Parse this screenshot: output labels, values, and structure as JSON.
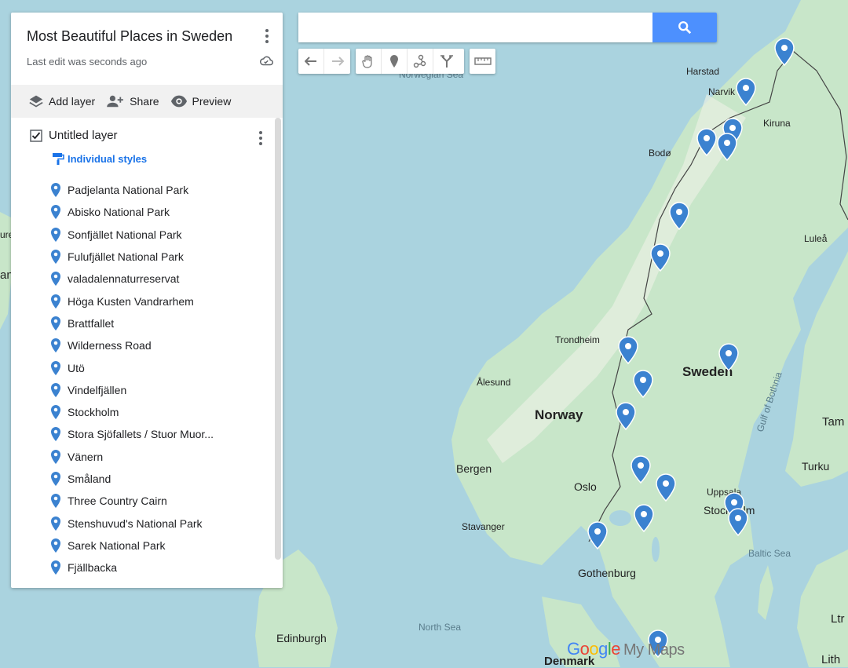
{
  "map_title": "Most Beautiful Places in Sweden",
  "map_subtitle": "Last edit was seconds ago",
  "toolbar": {
    "add_layer": "Add layer",
    "share": "Share",
    "preview": "Preview"
  },
  "layer": {
    "name": "Untitled layer",
    "checked": true,
    "styles_label": "Individual styles",
    "places": [
      "Padjelanta National Park",
      "Abisko National Park",
      "Sonfjället National Park",
      "Fulufjället National Park",
      "valadalennaturreservat",
      "Höga Kusten Vandrarhem",
      "Brattfallet",
      "Wilderness Road",
      "Utö",
      "Vindelfjällen",
      "Stockholm",
      "Stora Sjöfallets / Stuor Muor...",
      "Vänern",
      "Småland",
      "Three Country Cairn",
      "Stenshuvud's National Park",
      "Sarek National Park",
      "Fjällbacka"
    ]
  },
  "search": {
    "value": "",
    "placeholder": ""
  },
  "map": {
    "labels": {
      "norwegian_sea": "Norwegian Sea",
      "harstad": "Harstad",
      "narvik": "Narvik",
      "kiruna": "Kiruna",
      "bodo": "Bodø",
      "lulea": "Luleå",
      "trondheim": "Trondheim",
      "alesund": "Ålesund",
      "norway": "Norway",
      "sweden": "Sweden",
      "gulf_of_bothnia": "Gulf of Bothnia",
      "bergen": "Bergen",
      "oslo": "Oslo",
      "uppsala": "Uppsala",
      "stockholm": "Stockholm",
      "stavanger": "Stavanger",
      "turku": "Turku",
      "tam": "Tam",
      "baltic_sea": "Baltic Sea",
      "gothenburg": "Gothenburg",
      "north_sea": "North Sea",
      "edinburgh": "Edinburgh",
      "denmark": "Denmark",
      "lith": "Lith",
      "ltr": "Ltr",
      "an": "an",
      "ure": "ure"
    },
    "logo_google": "Google",
    "logo_mymaps": "My Maps",
    "colors": {
      "water": "#aad3df",
      "land": "#c8e6c9",
      "forest": "#a5d6a7",
      "pin": "#3b82d0"
    }
  }
}
